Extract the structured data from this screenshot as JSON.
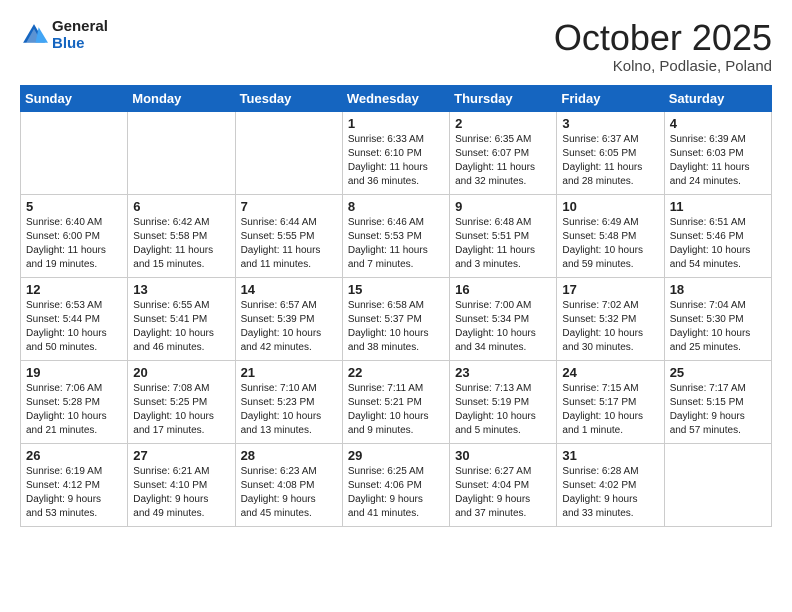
{
  "header": {
    "logo_line1": "General",
    "logo_line2": "Blue",
    "month": "October 2025",
    "location": "Kolno, Podlasie, Poland"
  },
  "weekdays": [
    "Sunday",
    "Monday",
    "Tuesday",
    "Wednesday",
    "Thursday",
    "Friday",
    "Saturday"
  ],
  "weeks": [
    [
      {
        "day": "",
        "info": ""
      },
      {
        "day": "",
        "info": ""
      },
      {
        "day": "",
        "info": ""
      },
      {
        "day": "1",
        "info": "Sunrise: 6:33 AM\nSunset: 6:10 PM\nDaylight: 11 hours\nand 36 minutes."
      },
      {
        "day": "2",
        "info": "Sunrise: 6:35 AM\nSunset: 6:07 PM\nDaylight: 11 hours\nand 32 minutes."
      },
      {
        "day": "3",
        "info": "Sunrise: 6:37 AM\nSunset: 6:05 PM\nDaylight: 11 hours\nand 28 minutes."
      },
      {
        "day": "4",
        "info": "Sunrise: 6:39 AM\nSunset: 6:03 PM\nDaylight: 11 hours\nand 24 minutes."
      }
    ],
    [
      {
        "day": "5",
        "info": "Sunrise: 6:40 AM\nSunset: 6:00 PM\nDaylight: 11 hours\nand 19 minutes."
      },
      {
        "day": "6",
        "info": "Sunrise: 6:42 AM\nSunset: 5:58 PM\nDaylight: 11 hours\nand 15 minutes."
      },
      {
        "day": "7",
        "info": "Sunrise: 6:44 AM\nSunset: 5:55 PM\nDaylight: 11 hours\nand 11 minutes."
      },
      {
        "day": "8",
        "info": "Sunrise: 6:46 AM\nSunset: 5:53 PM\nDaylight: 11 hours\nand 7 minutes."
      },
      {
        "day": "9",
        "info": "Sunrise: 6:48 AM\nSunset: 5:51 PM\nDaylight: 11 hours\nand 3 minutes."
      },
      {
        "day": "10",
        "info": "Sunrise: 6:49 AM\nSunset: 5:48 PM\nDaylight: 10 hours\nand 59 minutes."
      },
      {
        "day": "11",
        "info": "Sunrise: 6:51 AM\nSunset: 5:46 PM\nDaylight: 10 hours\nand 54 minutes."
      }
    ],
    [
      {
        "day": "12",
        "info": "Sunrise: 6:53 AM\nSunset: 5:44 PM\nDaylight: 10 hours\nand 50 minutes."
      },
      {
        "day": "13",
        "info": "Sunrise: 6:55 AM\nSunset: 5:41 PM\nDaylight: 10 hours\nand 46 minutes."
      },
      {
        "day": "14",
        "info": "Sunrise: 6:57 AM\nSunset: 5:39 PM\nDaylight: 10 hours\nand 42 minutes."
      },
      {
        "day": "15",
        "info": "Sunrise: 6:58 AM\nSunset: 5:37 PM\nDaylight: 10 hours\nand 38 minutes."
      },
      {
        "day": "16",
        "info": "Sunrise: 7:00 AM\nSunset: 5:34 PM\nDaylight: 10 hours\nand 34 minutes."
      },
      {
        "day": "17",
        "info": "Sunrise: 7:02 AM\nSunset: 5:32 PM\nDaylight: 10 hours\nand 30 minutes."
      },
      {
        "day": "18",
        "info": "Sunrise: 7:04 AM\nSunset: 5:30 PM\nDaylight: 10 hours\nand 25 minutes."
      }
    ],
    [
      {
        "day": "19",
        "info": "Sunrise: 7:06 AM\nSunset: 5:28 PM\nDaylight: 10 hours\nand 21 minutes."
      },
      {
        "day": "20",
        "info": "Sunrise: 7:08 AM\nSunset: 5:25 PM\nDaylight: 10 hours\nand 17 minutes."
      },
      {
        "day": "21",
        "info": "Sunrise: 7:10 AM\nSunset: 5:23 PM\nDaylight: 10 hours\nand 13 minutes."
      },
      {
        "day": "22",
        "info": "Sunrise: 7:11 AM\nSunset: 5:21 PM\nDaylight: 10 hours\nand 9 minutes."
      },
      {
        "day": "23",
        "info": "Sunrise: 7:13 AM\nSunset: 5:19 PM\nDaylight: 10 hours\nand 5 minutes."
      },
      {
        "day": "24",
        "info": "Sunrise: 7:15 AM\nSunset: 5:17 PM\nDaylight: 10 hours\nand 1 minute."
      },
      {
        "day": "25",
        "info": "Sunrise: 7:17 AM\nSunset: 5:15 PM\nDaylight: 9 hours\nand 57 minutes."
      }
    ],
    [
      {
        "day": "26",
        "info": "Sunrise: 6:19 AM\nSunset: 4:12 PM\nDaylight: 9 hours\nand 53 minutes."
      },
      {
        "day": "27",
        "info": "Sunrise: 6:21 AM\nSunset: 4:10 PM\nDaylight: 9 hours\nand 49 minutes."
      },
      {
        "day": "28",
        "info": "Sunrise: 6:23 AM\nSunset: 4:08 PM\nDaylight: 9 hours\nand 45 minutes."
      },
      {
        "day": "29",
        "info": "Sunrise: 6:25 AM\nSunset: 4:06 PM\nDaylight: 9 hours\nand 41 minutes."
      },
      {
        "day": "30",
        "info": "Sunrise: 6:27 AM\nSunset: 4:04 PM\nDaylight: 9 hours\nand 37 minutes."
      },
      {
        "day": "31",
        "info": "Sunrise: 6:28 AM\nSunset: 4:02 PM\nDaylight: 9 hours\nand 33 minutes."
      },
      {
        "day": "",
        "info": ""
      }
    ]
  ]
}
